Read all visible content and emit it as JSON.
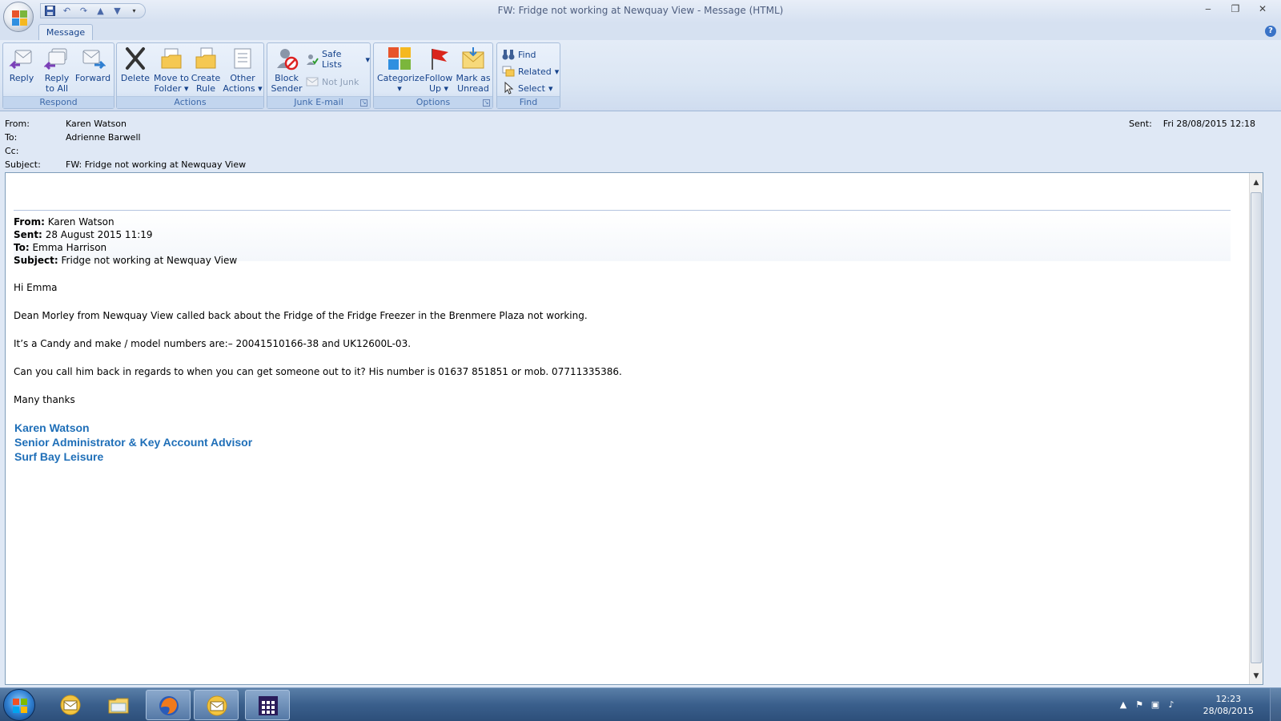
{
  "window": {
    "title": "FW: Fridge not working at Newquay View  - Message (HTML)",
    "controls": {
      "minimize": "‒",
      "maximize": "❐",
      "close": "✕"
    }
  },
  "tabs": {
    "message": "Message"
  },
  "ribbon": {
    "respond": {
      "label": "Respond",
      "reply": "Reply",
      "reply_all_1": "Reply",
      "reply_all_2": "to All",
      "forward": "Forward"
    },
    "actions": {
      "label": "Actions",
      "delete": "Delete",
      "move_1": "Move to",
      "move_2": "Folder",
      "rule_1": "Create",
      "rule_2": "Rule",
      "other_1": "Other",
      "other_2": "Actions"
    },
    "junk": {
      "label": "Junk E-mail",
      "block_1": "Block",
      "block_2": "Sender",
      "safe_lists": "Safe Lists",
      "not_junk": "Not Junk"
    },
    "options": {
      "label": "Options",
      "categorize": "Categorize",
      "follow_1": "Follow",
      "follow_2": "Up",
      "mark_1": "Mark as",
      "mark_2": "Unread"
    },
    "find": {
      "label": "Find",
      "find": "Find",
      "related": "Related",
      "select": "Select"
    }
  },
  "header": {
    "from_label": "From:",
    "from": "Karen Watson",
    "to_label": "To:",
    "to": "Adrienne Barwell",
    "cc_label": "Cc:",
    "cc": "",
    "subject_label": "Subject:",
    "subject": "FW: Fridge not working at Newquay View",
    "sent_label": "Sent:",
    "sent": "Fri 28/08/2015 12:18"
  },
  "message": {
    "fwd": {
      "from_label": "From:",
      "from": "Karen Watson",
      "sent_label": "Sent:",
      "sent": "28 August 2015 11:19",
      "to_label": "To:",
      "to": "Emma Harrison",
      "subject_label": "Subject:",
      "subject": "Fridge not working at Newquay View"
    },
    "greeting": "Hi Emma",
    "para1": "Dean Morley from Newquay View called back about the Fridge of the Fridge Freezer in the Brenmere Plaza not working.",
    "para2": "It’s a Candy and make / model numbers are:– 20041510166-38 and UK12600L-03.",
    "para3": "Can you call him back in regards to when you can get someone out to it? His number is 01637 851851 or mob. 07711335386.",
    "closing": "Many thanks",
    "signature": {
      "name": "Karen Watson",
      "title": "Senior Administrator & Key Account Advisor",
      "company": "Surf Bay Leisure"
    }
  },
  "taskbar": {
    "time": "12:23",
    "date": "28/08/2015"
  },
  "colors": {
    "signature": "#1f6fb8",
    "ribbon_label": "#15428b",
    "taskbar": "#3a5f8c"
  }
}
